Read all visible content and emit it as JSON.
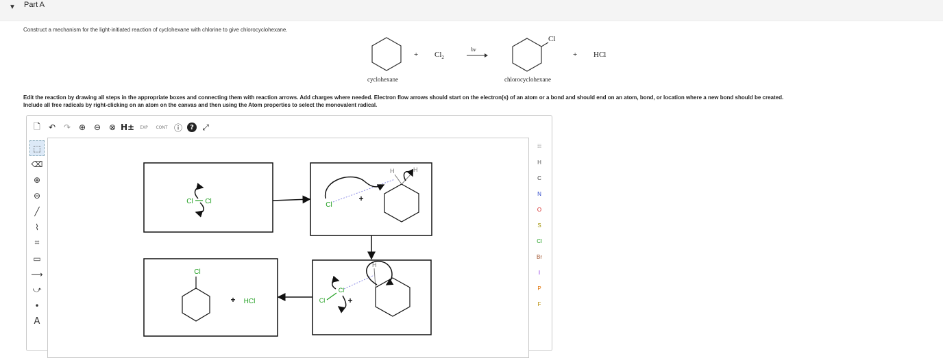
{
  "part": {
    "title": "Part A"
  },
  "question": {
    "prompt": "Construct a mechanism for the light-initiated reaction of cyclohexane with chlorine to give chlorocyclohexane.",
    "reaction": {
      "plus1": "+",
      "reagent": "Cl",
      "reagent_sub": "2",
      "condition": "hν",
      "plus2": "+",
      "byproduct": "HCl",
      "product_substituent": "Cl",
      "reactant_label": "cyclohexane",
      "product_label": "chlorocyclohexane"
    },
    "instructions_line1": "Edit the reaction by drawing all steps in the appropriate boxes and connecting them with reaction arrows. Add charges where needed. Electron flow arrows should start on the electron(s) of an atom or a bond and should end on an atom, bond, or location where a new bond should be created.",
    "instructions_line2": "Include all free radicals by right-clicking on an atom on the canvas and then using the Atom properties to select the monovalent radical."
  },
  "editor": {
    "toolbar": [
      {
        "name": "new-document-icon",
        "glyph": "🗋"
      },
      {
        "name": "undo-icon",
        "glyph": "↶"
      },
      {
        "name": "redo-icon",
        "glyph": "↷"
      },
      {
        "name": "zoom-in-icon",
        "glyph": "⊕"
      },
      {
        "name": "zoom-out-icon",
        "glyph": "⊖"
      },
      {
        "name": "zoom-fit-icon",
        "glyph": "⊗"
      },
      {
        "name": "add-hydrogens-button",
        "glyph": "H±"
      },
      {
        "name": "expand-button",
        "glyph": "EXP"
      },
      {
        "name": "contract-button",
        "glyph": "CONT"
      },
      {
        "name": "info-icon",
        "glyph": "ⓘ"
      },
      {
        "name": "help-icon",
        "glyph": "?"
      },
      {
        "name": "fullscreen-icon",
        "glyph": "⤢"
      }
    ],
    "left_tools": [
      {
        "name": "select-tool-icon",
        "glyph": "⬚"
      },
      {
        "name": "eraser-tool-icon",
        "glyph": "⌫"
      },
      {
        "name": "positive-charge-icon",
        "glyph": "⊕"
      },
      {
        "name": "negative-charge-icon",
        "glyph": "⊖"
      },
      {
        "name": "single-bond-icon",
        "glyph": "╱"
      },
      {
        "name": "chain-tool-icon",
        "glyph": "⌇"
      },
      {
        "name": "template-tool-icon",
        "glyph": "⌗"
      },
      {
        "name": "rectangle-tool-icon",
        "glyph": "▭"
      },
      {
        "name": "reaction-arrow-icon",
        "glyph": "⟶"
      },
      {
        "name": "electron-flow-arrow-icon",
        "glyph": "⤻"
      },
      {
        "name": "radical-dot-icon",
        "glyph": "•"
      },
      {
        "name": "atom-label-icon",
        "glyph": "A"
      }
    ],
    "atoms": [
      {
        "label": "H",
        "color": "#555555"
      },
      {
        "label": "C",
        "color": "#333333"
      },
      {
        "label": "N",
        "color": "#2a45c9"
      },
      {
        "label": "O",
        "color": "#d42020"
      },
      {
        "label": "S",
        "color": "#a09000"
      },
      {
        "label": "Cl",
        "color": "#1f9e1f"
      },
      {
        "label": "Br",
        "color": "#a0522d"
      },
      {
        "label": "I",
        "color": "#8a2be2"
      },
      {
        "label": "P",
        "color": "#e07000"
      },
      {
        "label": "F",
        "color": "#b58a00"
      }
    ],
    "periodic_table_icon": "periodic-table-icon",
    "canvas": {
      "step1_chlorine": "Cl",
      "step2_chlorine": "Cl",
      "step2_plus": "+",
      "step2_h1": "H",
      "step2_h2": "H",
      "step3_plus": "+",
      "step3_h": "H",
      "step3_cl_left": "Cl",
      "step3_cl_right": "Cl",
      "step4_substituent": "Cl",
      "step4_plus": "+",
      "step4_hcl": "HCl"
    },
    "colors": {
      "chlorine": "#1f9e1f",
      "dashed_bond": "#8a8ae6"
    }
  }
}
